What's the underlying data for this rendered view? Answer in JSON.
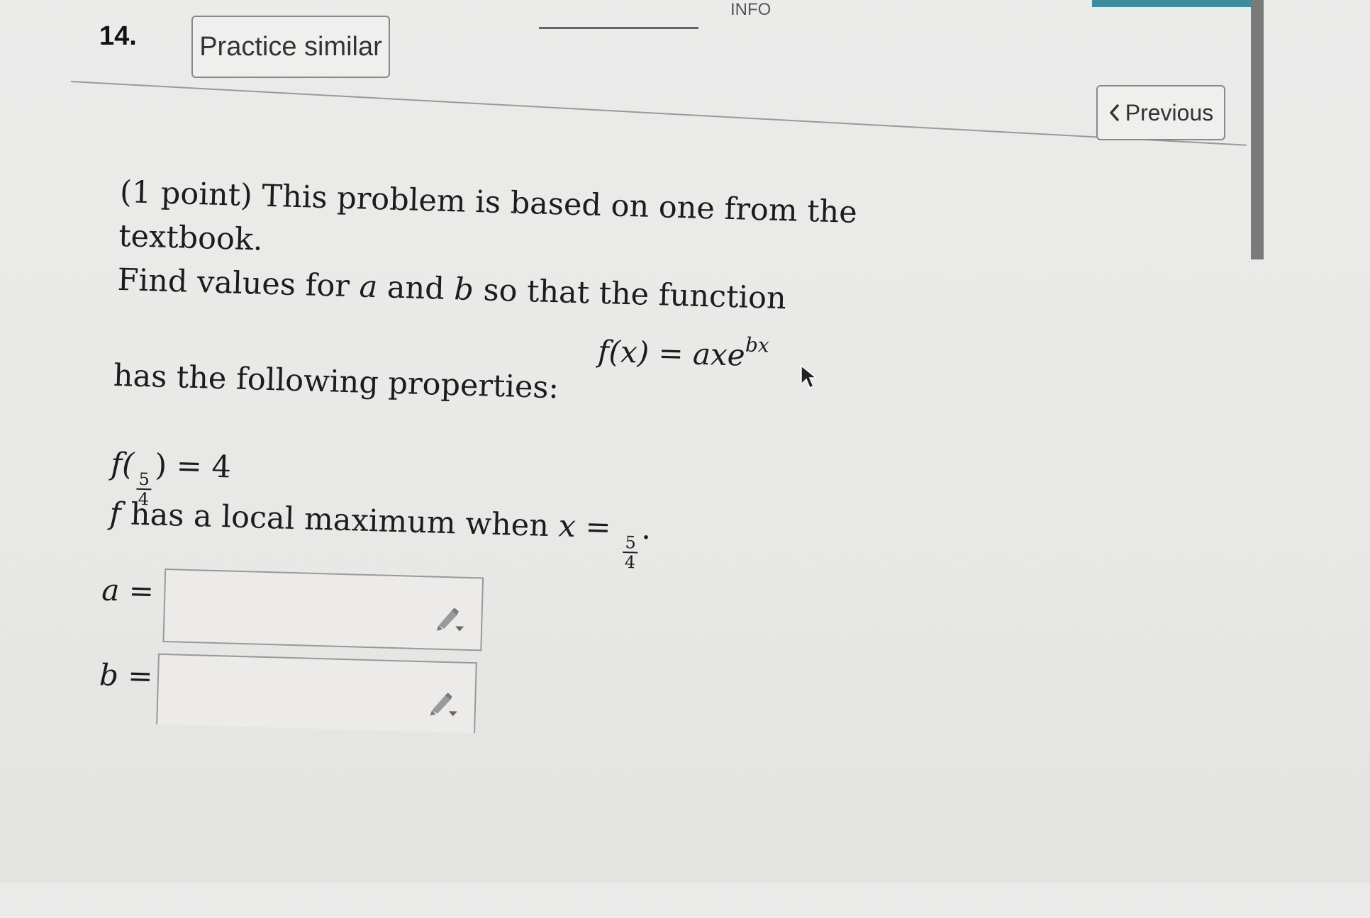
{
  "header": {
    "top_tab_label": "INFO",
    "problem_number": "14.",
    "practice_button_label": "Practice similar",
    "previous_button_label": "Previous"
  },
  "problem": {
    "intro_line1": "(1 point) This problem is based on one from the textbook.",
    "intro_line2_prefix": "Find values for",
    "var_a": "a",
    "and_word": "and",
    "var_b": "b",
    "intro_line2_suffix": "so that the function",
    "formula": {
      "lhs": "f(x)",
      "equals": "=",
      "rhs_base": "axe",
      "rhs_exponent": "bx"
    },
    "properties_intro": "has the following properties:",
    "property1": {
      "func": "f(",
      "frac_num": "5",
      "frac_den": "4",
      "rest": ") = 4"
    },
    "property2": {
      "func": "f",
      "text": "has a local maximum when",
      "var": "x",
      "equals": "=",
      "frac_num": "5",
      "frac_den": "4",
      "end": "."
    }
  },
  "answers": {
    "a_label": "a =",
    "b_label": "b =",
    "a_value": "",
    "b_value": ""
  },
  "icons": {
    "previous": "chevron-left-icon",
    "answer_tool": "pencil-dropdown-icon",
    "pointer": "mouse-cursor-icon"
  },
  "colors": {
    "accent": "#3f8d9c",
    "background": "#ebebea"
  }
}
